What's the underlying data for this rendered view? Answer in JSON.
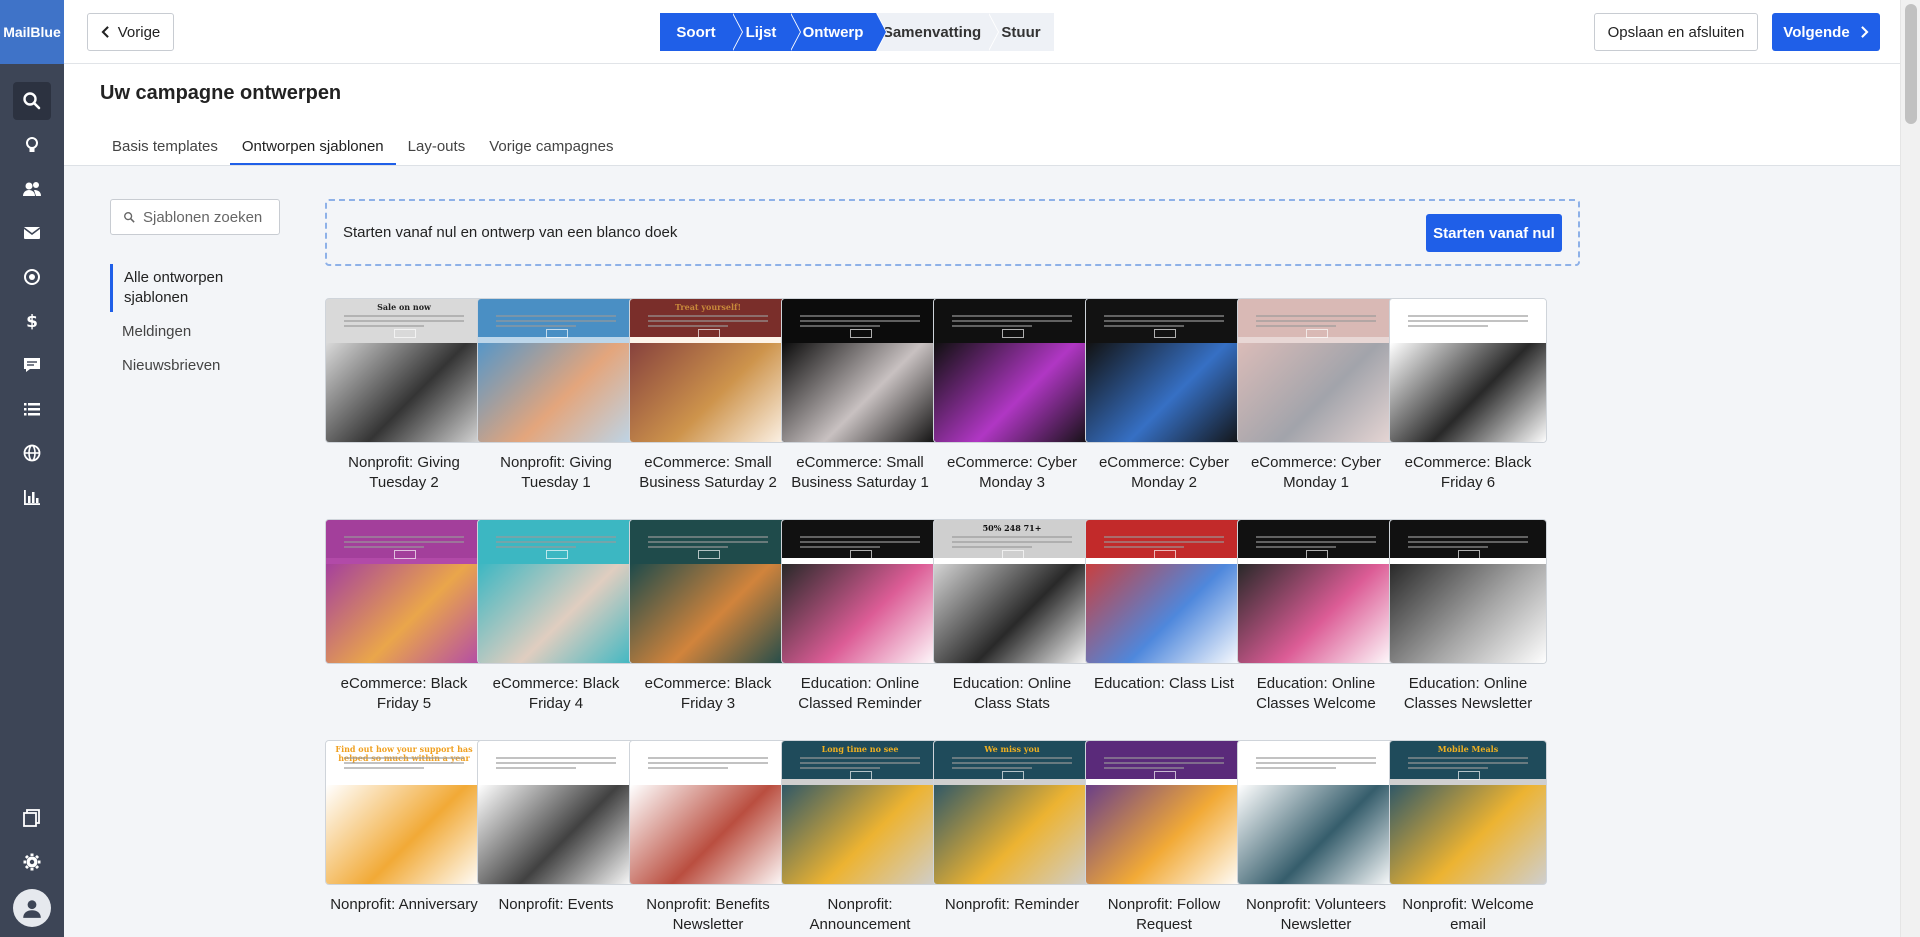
{
  "brand": "MailBlue",
  "nav": {
    "icons": [
      "search-icon",
      "lightbulb-icon",
      "contacts-icon",
      "mail-icon",
      "target-icon",
      "dollar-icon",
      "chat-icon",
      "list-icon",
      "globe-icon",
      "bar-chart-icon"
    ],
    "bottom_icons": [
      "pages-icon",
      "gear-icon",
      "user-avatar-icon"
    ]
  },
  "topbar": {
    "back_label": "Vorige",
    "steps": [
      {
        "label": "Soort",
        "state": "done"
      },
      {
        "label": "Lijst",
        "state": "done"
      },
      {
        "label": "Ontwerp",
        "state": "done"
      },
      {
        "label": "Samenvatting",
        "state": "todo"
      },
      {
        "label": "Stuur",
        "state": "todo"
      }
    ],
    "save_label": "Opslaan en afsluiten",
    "next_label": "Volgende"
  },
  "page": {
    "title": "Uw campagne ontwerpen",
    "tabs": [
      {
        "label": "Basis templates",
        "active": false
      },
      {
        "label": "Ontworpen sjablonen",
        "active": true
      },
      {
        "label": "Lay-outs",
        "active": false
      },
      {
        "label": "Vorige campagnes",
        "active": false
      }
    ]
  },
  "sidebar": {
    "search_placeholder": "Sjablonen zoeken",
    "categories": [
      {
        "label": "Alle ontworpen sjablonen",
        "active": true
      },
      {
        "label": "Meldingen",
        "active": false
      },
      {
        "label": "Nieuwsbrieven",
        "active": false
      }
    ]
  },
  "blank": {
    "text": "Starten vanaf nul en ontwerp van een blanco doek",
    "button": "Starten vanaf nul"
  },
  "templates": [
    {
      "label": "Nonprofit: Giving Tuesday 2",
      "bg": "#d9d9d9",
      "top": "#d9d9d9",
      "accent": "#222222",
      "heading": "Sale on now"
    },
    {
      "label": "Nonprofit: Giving Tuesday 1",
      "bg": "#bcd6ea",
      "top": "#4a8fc4",
      "accent": "#e8a070",
      "heading": ""
    },
    {
      "label": "eCommerce: Small Business Saturday 2",
      "bg": "#fdf4ea",
      "top": "#7a2e2a",
      "accent": "#c8893a",
      "heading": "Treat yourself!"
    },
    {
      "label": "eCommerce: Small Business Saturday 1",
      "bg": "#0c0c0c",
      "top": "#0c0c0c",
      "accent": "#ddd5d5",
      "heading": ""
    },
    {
      "label": "eCommerce: Cyber Monday 3",
      "bg": "#101010",
      "top": "#101010",
      "accent": "#c23bd8",
      "heading": ""
    },
    {
      "label": "eCommerce: Cyber Monday 2",
      "bg": "#121212",
      "top": "#121212",
      "accent": "#3a7ad8",
      "heading": ""
    },
    {
      "label": "eCommerce: Cyber Monday 1",
      "bg": "#e8d7d5",
      "top": "#d9b9b5",
      "accent": "#9a9ea6",
      "heading": ""
    },
    {
      "label": "eCommerce: Black Friday 6",
      "bg": "#ffffff",
      "top": "#ffffff",
      "accent": "#111111",
      "heading": ""
    },
    {
      "label": "eCommerce: Black Friday 5",
      "bg": "#b24aa8",
      "top": "#a33f9b",
      "accent": "#f0b040",
      "heading": ""
    },
    {
      "label": "eCommerce: Black Friday 4",
      "bg": "#3cb7c2",
      "top": "#3cb7c2",
      "accent": "#f2d0c0",
      "heading": ""
    },
    {
      "label": "eCommerce: Black Friday 3",
      "bg": "#1f4b4b",
      "top": "#1f4b4b",
      "accent": "#e58a3a",
      "heading": ""
    },
    {
      "label": "Education: Online Classed Reminder",
      "bg": "#ffffff",
      "top": "#111111",
      "accent": "#d84a8a",
      "heading": ""
    },
    {
      "label": "Education: Online Class Stats",
      "bg": "#ffffff",
      "top": "#cfcfcf",
      "accent": "#111111",
      "heading": "50%  248  71+"
    },
    {
      "label": "Education: Class List",
      "bg": "#ffffff",
      "top": "#c22a2a",
      "accent": "#3b7ad8",
      "heading": ""
    },
    {
      "label": "Education: Online Classes Welcome",
      "bg": "#ffffff",
      "top": "#111111",
      "accent": "#d84a8a",
      "heading": ""
    },
    {
      "label": "Education: Online Classes Newsletter",
      "bg": "#ffffff",
      "top": "#111111",
      "accent": "#9a9a9a",
      "heading": ""
    },
    {
      "label": "Nonprofit: Anniversary",
      "bg": "#ffffff",
      "top": "#ffffff",
      "accent": "#f0a020",
      "heading": "Find out how your support has helped so much within a year"
    },
    {
      "label": "Nonprofit: Events",
      "bg": "#ffffff",
      "top": "#ffffff",
      "accent": "#2c2c2c",
      "heading": ""
    },
    {
      "label": "Nonprofit: Benefits Newsletter",
      "bg": "#ffffff",
      "top": "#ffffff",
      "accent": "#b23a2a",
      "heading": ""
    },
    {
      "label": "Nonprofit: Announcement",
      "bg": "#cfcfcf",
      "top": "#1f4b5b",
      "accent": "#f0b020",
      "heading": "Long time no see"
    },
    {
      "label": "Nonprofit: Reminder",
      "bg": "#cfcfcf",
      "top": "#1f4b5b",
      "accent": "#f0b020",
      "heading": "We miss you"
    },
    {
      "label": "Nonprofit: Follow Request",
      "bg": "#ffffff",
      "top": "#5a2a7a",
      "accent": "#f0a020",
      "heading": ""
    },
    {
      "label": "Nonprofit: Volunteers Newsletter",
      "bg": "#ffffff",
      "top": "#ffffff",
      "accent": "#1f4b5b",
      "heading": ""
    },
    {
      "label": "Nonprofit: Welcome email",
      "bg": "#cfcfcf",
      "top": "#1f4b5b",
      "accent": "#f0b020",
      "heading": "Mobile Meals"
    }
  ],
  "colors": {
    "primary": "#1f5fe8",
    "nav_bg": "#3d4556",
    "brand_bg": "#3f73c8"
  }
}
